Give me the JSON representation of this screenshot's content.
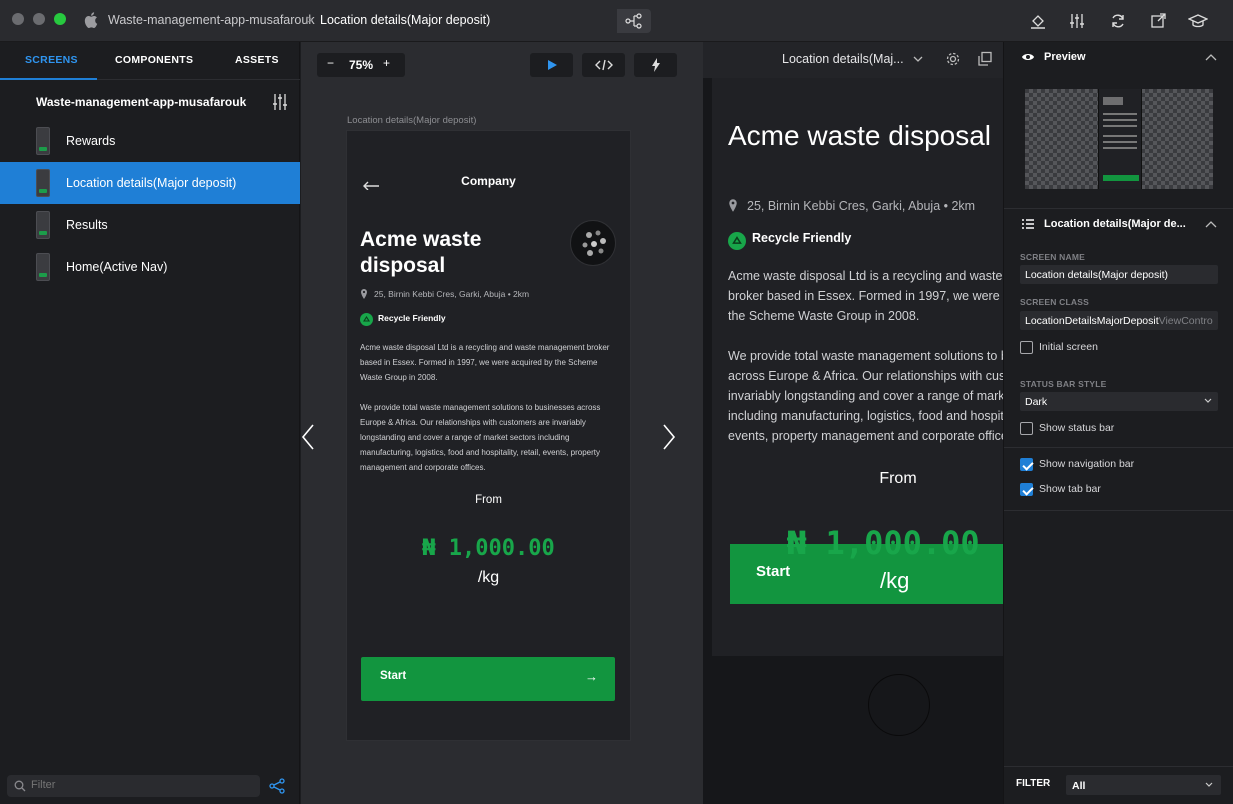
{
  "titlebar": {
    "project": "Waste-management-app-musafarouk",
    "separator": ">",
    "screen": "Location details(Major deposit)"
  },
  "sidebar": {
    "tabs": [
      {
        "label": "SCREENS",
        "active": true
      },
      {
        "label": "COMPONENTS",
        "active": false
      },
      {
        "label": "ASSETS",
        "active": false
      }
    ],
    "project_name": "Waste-management-app-musafarouk",
    "screens": [
      {
        "label": "Rewards",
        "active": false
      },
      {
        "label": "Location details(Major deposit)",
        "active": true
      },
      {
        "label": "Results",
        "active": false
      },
      {
        "label": "Home(Active Nav)",
        "active": false
      }
    ],
    "filter_placeholder": "Filter"
  },
  "canvas": {
    "zoom_minus": "−",
    "zoom": "75%",
    "zoom_plus": "+",
    "frame_label": "Location details(Major deposit)"
  },
  "app_screen": {
    "header": "Company",
    "title": "Acme waste disposal",
    "address": "25, Birnin Kebbi Cres, Garki, Abuja • 2km",
    "badge": "Recycle Friendly",
    "desc_1": "Acme waste disposal Ltd is a recycling and waste management broker based in Essex. Formed in 1997, we were acquired by the Scheme Waste Group in 2008.",
    "desc_2": "We provide total waste management solutions to businesses across Europe & Africa. Our relationships with customers are invariably longstanding and cover a range of market sectors including manufacturing, logistics, food and hospitality, retail, events, property management and corporate offices.",
    "from": "From",
    "price": "₦ 1,000.00",
    "unit": "/kg",
    "start": "Start",
    "start_arrow": "→"
  },
  "device_preview": {
    "screen_name": "Location details(Maj..."
  },
  "inspector": {
    "preview_title": "Preview",
    "screen_section_title": "Location details(Major de...",
    "screen_name_label": "SCREEN NAME",
    "screen_name_value": "Location details(Major deposit)",
    "screen_class_label": "SCREEN CLASS",
    "screen_class_value": "LocationDetailsMajorDeposit",
    "screen_class_suffix": "ViewContro",
    "initial_screen": {
      "label": "Initial screen",
      "checked": false
    },
    "status_bar_style_label": "STATUS BAR STYLE",
    "status_bar_style_value": "Dark",
    "show_status_bar": {
      "label": "Show status bar",
      "checked": false
    },
    "show_navigation_bar": {
      "label": "Show navigation bar",
      "checked": true
    },
    "show_tab_bar": {
      "label": "Show tab bar",
      "checked": true
    },
    "filter_label": "FILTER",
    "filter_value": "All"
  },
  "colors": {
    "accent": "#1f7fd6",
    "brand_green": "#12953f",
    "price_green": "#18a64a",
    "background": "#1c1d20"
  },
  "icons": [
    "apple-icon",
    "device-icon",
    "flow-icon",
    "paint-bucket-icon",
    "sliders-icon",
    "refresh-icon",
    "external-link-icon",
    "graduation-cap-icon",
    "play-icon",
    "code-icon",
    "bolt-icon",
    "back-arrow-icon",
    "location-pin-icon",
    "recycle-icon",
    "chevron-left-icon",
    "chevron-right-icon",
    "gear-icon",
    "duplicate-icon",
    "eye-icon",
    "list-icon",
    "search-icon",
    "share-icon"
  ]
}
